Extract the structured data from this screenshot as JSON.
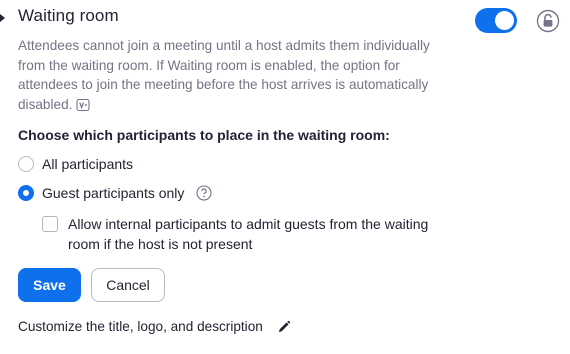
{
  "setting": {
    "title": "Waiting room",
    "enabled": true,
    "locked": false,
    "accent_color": "#0e71eb",
    "description": "Attendees cannot join a meeting until a host admits them individually from the waiting room. If Waiting room is enabled, the option for attendees to join the meeting before the host arrives is automatically disabled.",
    "description_icon": "version-icon"
  },
  "participants": {
    "question": "Choose which participants to place in the waiting room:",
    "options": [
      {
        "label": "All participants",
        "selected": false
      },
      {
        "label": "Guest participants only",
        "selected": true,
        "help_icon": "question-mark-icon"
      }
    ],
    "sub_option": {
      "label": "Allow internal participants to admit guests from the waiting room if the host is not present",
      "checked": false
    }
  },
  "buttons": {
    "save_label": "Save",
    "cancel_label": "Cancel"
  },
  "customize": {
    "label": "Customize the title, logo, and description",
    "icon": "pencil-icon"
  }
}
